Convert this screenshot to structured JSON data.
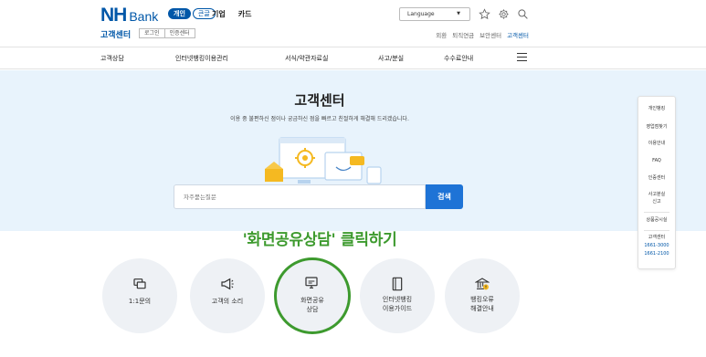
{
  "brand": {
    "logo_nh": "NH",
    "logo_bank": "Bank",
    "center_title": "고객센터",
    "primary": "#0057a8",
    "accent_green": "#3d9a2e"
  },
  "header": {
    "segments": [
      "개인",
      "큰글"
    ],
    "top_links": [
      "기업",
      "카드"
    ],
    "mini_buttons": [
      "로그인",
      "인증센터"
    ],
    "language": "Language",
    "icons": [
      "star-icon",
      "gear-icon",
      "search-icon"
    ],
    "right_links": [
      "외환",
      "퇴직연금",
      "보안센터",
      "고객센터"
    ]
  },
  "nav": [
    "고객상담",
    "인터넷뱅킹이용관리",
    "서식/약관자료실",
    "사고/분실",
    "수수료안내"
  ],
  "hero": {
    "title": "고객센터",
    "desc": "이용 중 불편하신 점이나 궁금하신 점을 빠르고 친절하게 해결해 드리겠습니다.",
    "search_placeholder": "자주묻는질문",
    "search_button": "검색"
  },
  "quick_menu": {
    "items": [
      "개인뱅킹",
      "영업점찾기",
      "이용안내",
      "FAQ",
      "인증센터",
      "사고분실",
      "신고",
      "상품공시실",
      "고객센터"
    ],
    "phones": [
      "1661-3000",
      "1661-2100"
    ]
  },
  "promo": "'화면공유상담' 클릭하기",
  "circles": [
    {
      "l1": "1:1문의",
      "l2": "",
      "icon": "chat-icon"
    },
    {
      "l1": "고객의 소리",
      "l2": "",
      "icon": "megaphone-icon"
    },
    {
      "l1": "화면공유",
      "l2": "상담",
      "icon": "screen-share-icon"
    },
    {
      "l1": "인터넷뱅킹",
      "l2": "이용가이드",
      "icon": "book-icon"
    },
    {
      "l1": "뱅킹오류",
      "l2": "해결안내",
      "icon": "bank-error-icon"
    }
  ]
}
